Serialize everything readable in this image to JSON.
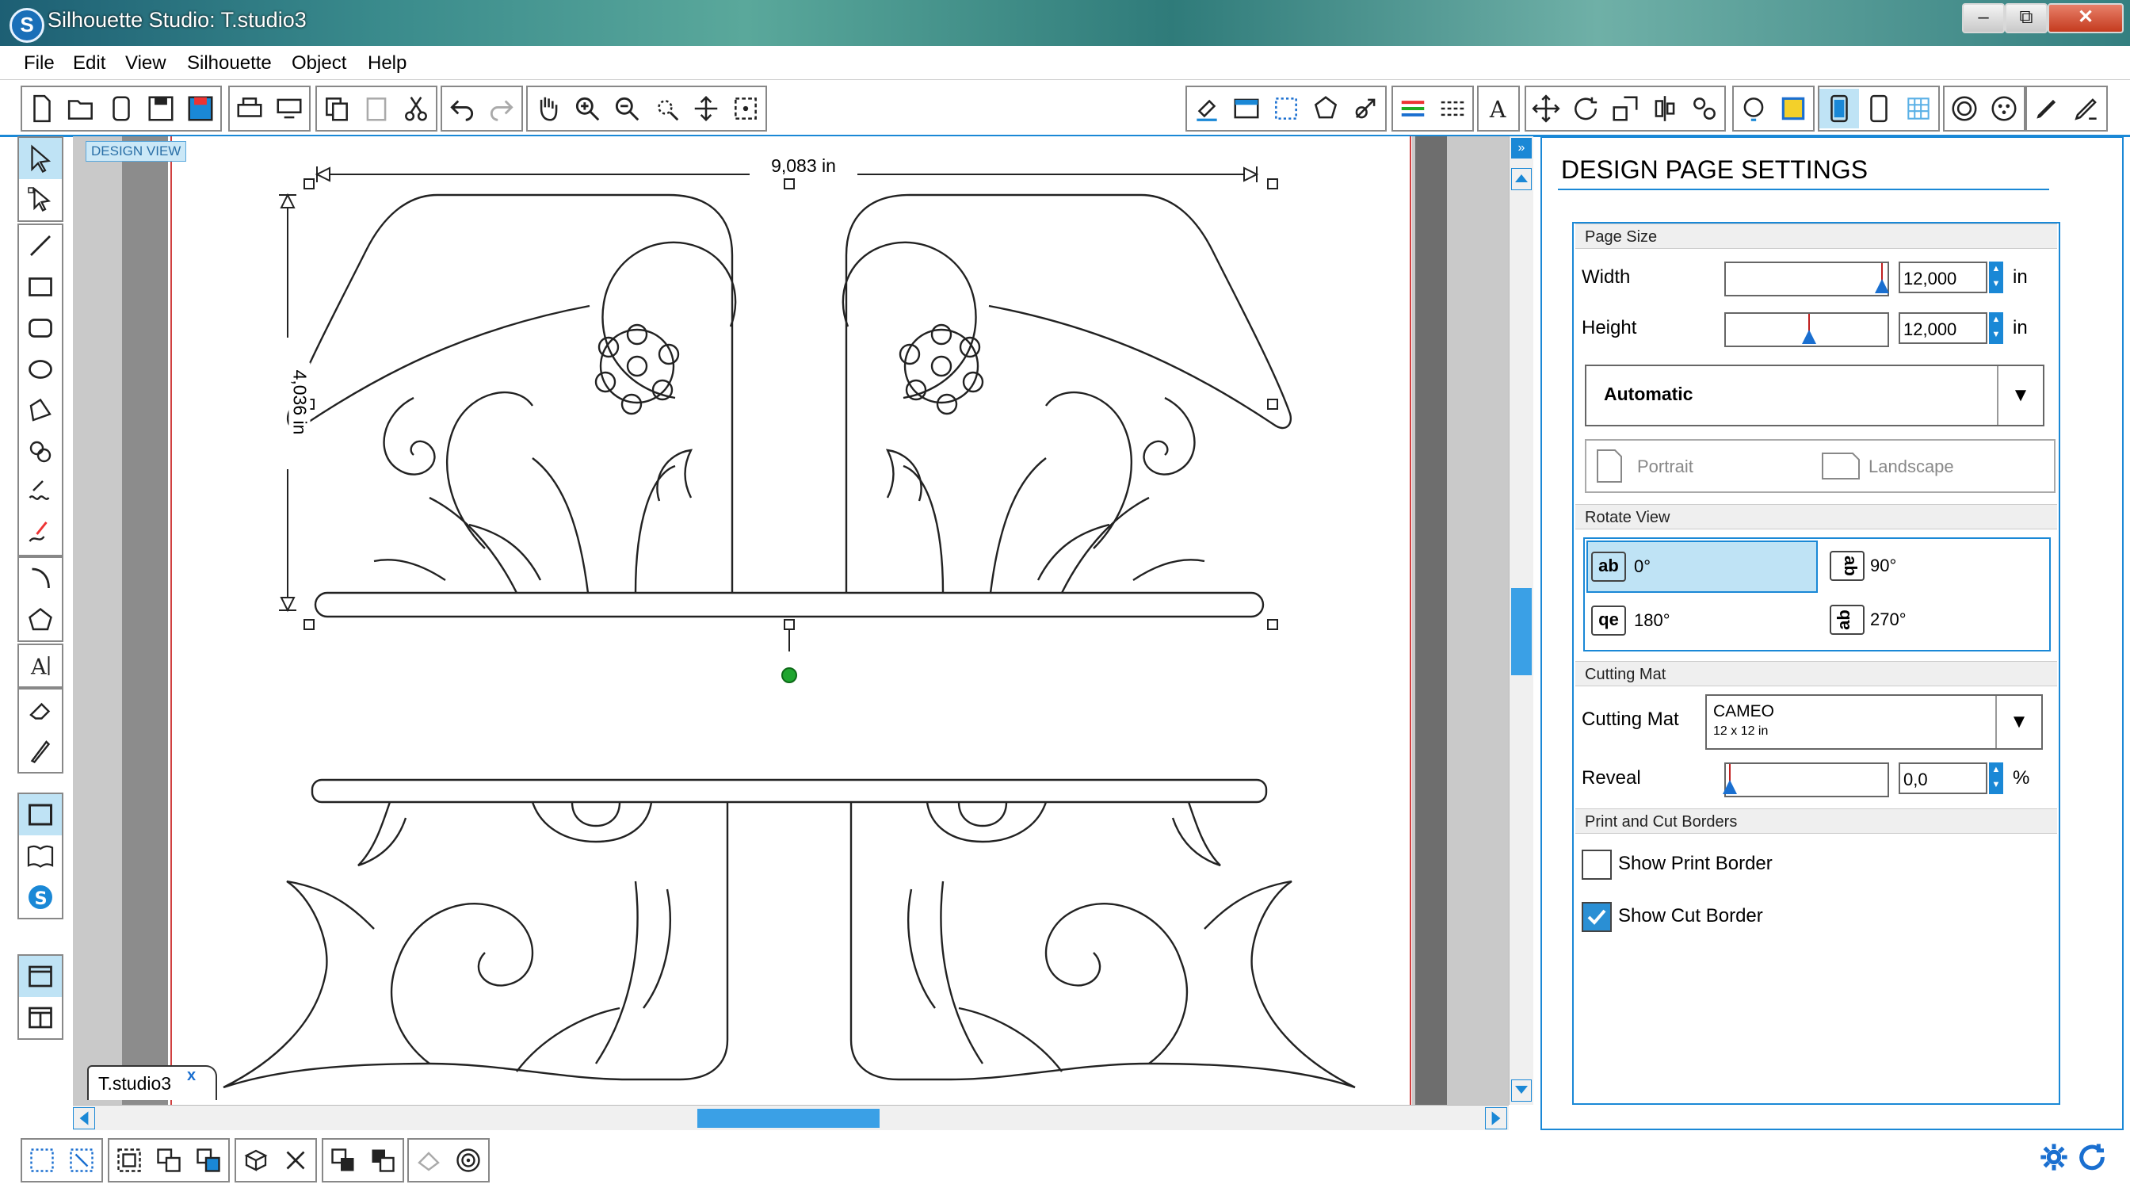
{
  "window": {
    "title": "Silhouette Studio: T.studio3",
    "controls": [
      "–",
      "⧉",
      "✕"
    ]
  },
  "menu": [
    "File",
    "Edit",
    "View",
    "Silhouette",
    "Object",
    "Help"
  ],
  "canvas": {
    "view_label": "DESIGN VIEW",
    "width_dimension": "9,083 in",
    "height_dimension": "4,036 in",
    "document_tab": "T.studio3",
    "tab_close": "x"
  },
  "panel": {
    "title": "DESIGN PAGE SETTINGS",
    "page_size": {
      "section": "Page Size",
      "width_label": "Width",
      "width_value": "12,000",
      "height_label": "Height",
      "height_value": "12,000",
      "unit": "in",
      "preset": "Automatic",
      "portrait": "Portrait",
      "landscape": "Landscape"
    },
    "rotate_view": {
      "section": "Rotate View",
      "options": [
        {
          "icon": "ab",
          "label": "0°",
          "selected": true
        },
        {
          "icon": "ab",
          "label": "90°",
          "selected": false
        },
        {
          "icon": "qe",
          "label": "180°",
          "selected": false
        },
        {
          "icon": "ab",
          "label": "270°",
          "selected": false
        }
      ]
    },
    "cutting_mat": {
      "section": "Cutting Mat",
      "label": "Cutting Mat",
      "value": "CAMEO",
      "sub": "12 x 12 in",
      "reveal_label": "Reveal",
      "reveal_value": "0,0",
      "reveal_unit": "%"
    },
    "borders": {
      "section": "Print and Cut Borders",
      "print_border_label": "Show Print Border",
      "print_border_checked": false,
      "cut_border_label": "Show Cut Border",
      "cut_border_checked": true
    }
  },
  "colors": {
    "accent": "#1a88d6",
    "selected_bg": "#bfe3f5",
    "handle_green": "#1fa52f"
  }
}
